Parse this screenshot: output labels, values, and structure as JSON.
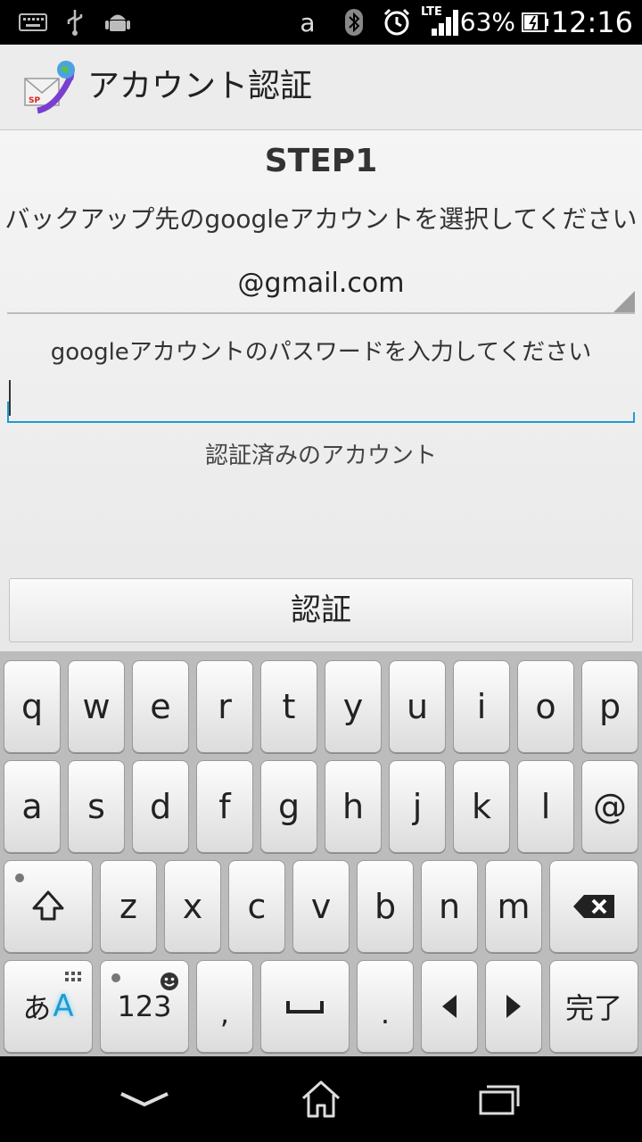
{
  "status_bar": {
    "icons": [
      "keyboard-icon",
      "usb-icon",
      "android-icon",
      "amazon-icon",
      "bluetooth-icon",
      "alarm-icon",
      "lte-signal-icon",
      "battery-icon"
    ],
    "lte_label": "LTE",
    "amazon_label": "a",
    "battery_percent": "63%",
    "time": "12:16"
  },
  "app_bar": {
    "title": "アカウント認証",
    "icon": "app-mail-globe-icon"
  },
  "content": {
    "step_title": "STEP1",
    "select_prompt": "バックアップ先のgoogleアカウントを選択してください",
    "account_value": "@gmail.com",
    "password_prompt": "googleアカウントのパスワードを入力してください",
    "password_value": "",
    "verified_label": "認証済みのアカウント",
    "auth_button": "認証"
  },
  "keyboard": {
    "row1": [
      "q",
      "w",
      "e",
      "r",
      "t",
      "y",
      "u",
      "i",
      "o",
      "p"
    ],
    "row2": [
      "a",
      "s",
      "d",
      "f",
      "g",
      "h",
      "j",
      "k",
      "l",
      "@"
    ],
    "row3": [
      "z",
      "x",
      "c",
      "v",
      "b",
      "n",
      "m"
    ],
    "row4": {
      "mode_kana": "あ",
      "mode_alpha": "A",
      "numbers": "123",
      "comma": ",",
      "period": ".",
      "done": "完了"
    },
    "accent_color": "#1f9bd1"
  },
  "nav_bar": {
    "icons": [
      "back-chevron-icon",
      "home-icon",
      "recent-apps-icon"
    ]
  }
}
